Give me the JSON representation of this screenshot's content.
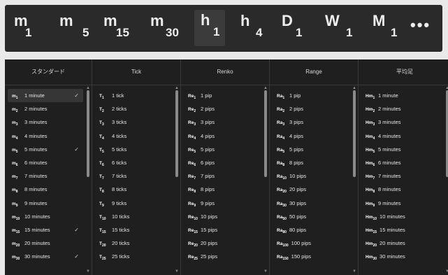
{
  "toolbar": {
    "items": [
      {
        "unit": "m",
        "num": "1"
      },
      {
        "unit": "m",
        "num": "5"
      },
      {
        "unit": "m",
        "num": "15"
      },
      {
        "unit": "m",
        "num": "30"
      },
      {
        "unit": "h",
        "num": "1"
      },
      {
        "unit": "h",
        "num": "4"
      },
      {
        "unit": "D",
        "num": "1"
      },
      {
        "unit": "W",
        "num": "1"
      },
      {
        "unit": "M",
        "num": "1"
      }
    ],
    "more": "•••"
  },
  "columns": [
    {
      "title": "スタンダード",
      "icon": "m",
      "items": [
        {
          "sub": "1",
          "label": "1 minute",
          "checked": true,
          "selected": true
        },
        {
          "sub": "2",
          "label": "2 minutes",
          "checked": false
        },
        {
          "sub": "3",
          "label": "3 minutes",
          "checked": false
        },
        {
          "sub": "4",
          "label": "4 minutes",
          "checked": false
        },
        {
          "sub": "5",
          "label": "5 minutes",
          "checked": true
        },
        {
          "sub": "6",
          "label": "6 minutes",
          "checked": false
        },
        {
          "sub": "7",
          "label": "7 minutes",
          "checked": false
        },
        {
          "sub": "8",
          "label": "8 minutes",
          "checked": false
        },
        {
          "sub": "9",
          "label": "9 minutes",
          "checked": false
        },
        {
          "sub": "10",
          "label": "10 minutes",
          "checked": false
        },
        {
          "sub": "15",
          "label": "15 minutes",
          "checked": true
        },
        {
          "sub": "20",
          "label": "20 minutes",
          "checked": false
        },
        {
          "sub": "30",
          "label": "30 minutes",
          "checked": true
        }
      ]
    },
    {
      "title": "Tick",
      "icon": "T",
      "items": [
        {
          "sub": "1",
          "label": "1 tick"
        },
        {
          "sub": "2",
          "label": "2 ticks"
        },
        {
          "sub": "3",
          "label": "3 ticks"
        },
        {
          "sub": "4",
          "label": "4 ticks"
        },
        {
          "sub": "5",
          "label": "5 ticks"
        },
        {
          "sub": "6",
          "label": "6 ticks"
        },
        {
          "sub": "7",
          "label": "7 ticks"
        },
        {
          "sub": "8",
          "label": "8 ticks"
        },
        {
          "sub": "9",
          "label": "9 ticks"
        },
        {
          "sub": "10",
          "label": "10 ticks"
        },
        {
          "sub": "15",
          "label": "15 ticks"
        },
        {
          "sub": "20",
          "label": "20 ticks"
        },
        {
          "sub": "25",
          "label": "25 ticks"
        }
      ]
    },
    {
      "title": "Renko",
      "icon": "Re",
      "items": [
        {
          "sub": "1",
          "label": "1 pip"
        },
        {
          "sub": "2",
          "label": "2 pips"
        },
        {
          "sub": "3",
          "label": "3 pips"
        },
        {
          "sub": "4",
          "label": "4 pips"
        },
        {
          "sub": "5",
          "label": "5 pips"
        },
        {
          "sub": "6",
          "label": "6 pips"
        },
        {
          "sub": "7",
          "label": "7 pips"
        },
        {
          "sub": "8",
          "label": "8 pips"
        },
        {
          "sub": "9",
          "label": "9 pips"
        },
        {
          "sub": "10",
          "label": "10 pips"
        },
        {
          "sub": "15",
          "label": "15 pips"
        },
        {
          "sub": "20",
          "label": "20 pips"
        },
        {
          "sub": "25",
          "label": "25 pips"
        }
      ]
    },
    {
      "title": "Range",
      "icon": "Ra",
      "items": [
        {
          "sub": "1",
          "label": "1 pip"
        },
        {
          "sub": "2",
          "label": "2 pips"
        },
        {
          "sub": "3",
          "label": "3 pips"
        },
        {
          "sub": "4",
          "label": "4 pips"
        },
        {
          "sub": "5",
          "label": "5 pips"
        },
        {
          "sub": "8",
          "label": "8 pips"
        },
        {
          "sub": "10",
          "label": "10 pips"
        },
        {
          "sub": "20",
          "label": "20 pips"
        },
        {
          "sub": "30",
          "label": "30 pips"
        },
        {
          "sub": "50",
          "label": "50 pips"
        },
        {
          "sub": "80",
          "label": "80 pips"
        },
        {
          "sub": "100",
          "label": "100 pips"
        },
        {
          "sub": "150",
          "label": "150 pips"
        }
      ]
    },
    {
      "title": "平均足",
      "icon": "Hm",
      "items": [
        {
          "sub": "1",
          "label": "1 minute"
        },
        {
          "sub": "2",
          "label": "2 minutes"
        },
        {
          "sub": "3",
          "label": "3 minutes"
        },
        {
          "sub": "4",
          "label": "4 minutes"
        },
        {
          "sub": "5",
          "label": "5 minutes"
        },
        {
          "sub": "6",
          "label": "6 minutes"
        },
        {
          "sub": "7",
          "label": "7 minutes"
        },
        {
          "sub": "8",
          "label": "8 minutes"
        },
        {
          "sub": "9",
          "label": "9 minutes"
        },
        {
          "sub": "10",
          "label": "10 minutes"
        },
        {
          "sub": "15",
          "label": "15 minutes"
        },
        {
          "sub": "20",
          "label": "20 minutes"
        },
        {
          "sub": "30",
          "label": "30 minutes"
        }
      ]
    }
  ],
  "active_toolbar": "h1",
  "colors": {
    "toolbar_bg": "#2a2a2a",
    "panel_bg": "#1f1f1f",
    "text": "#e6e6e6",
    "selected_bg": "#363636"
  }
}
